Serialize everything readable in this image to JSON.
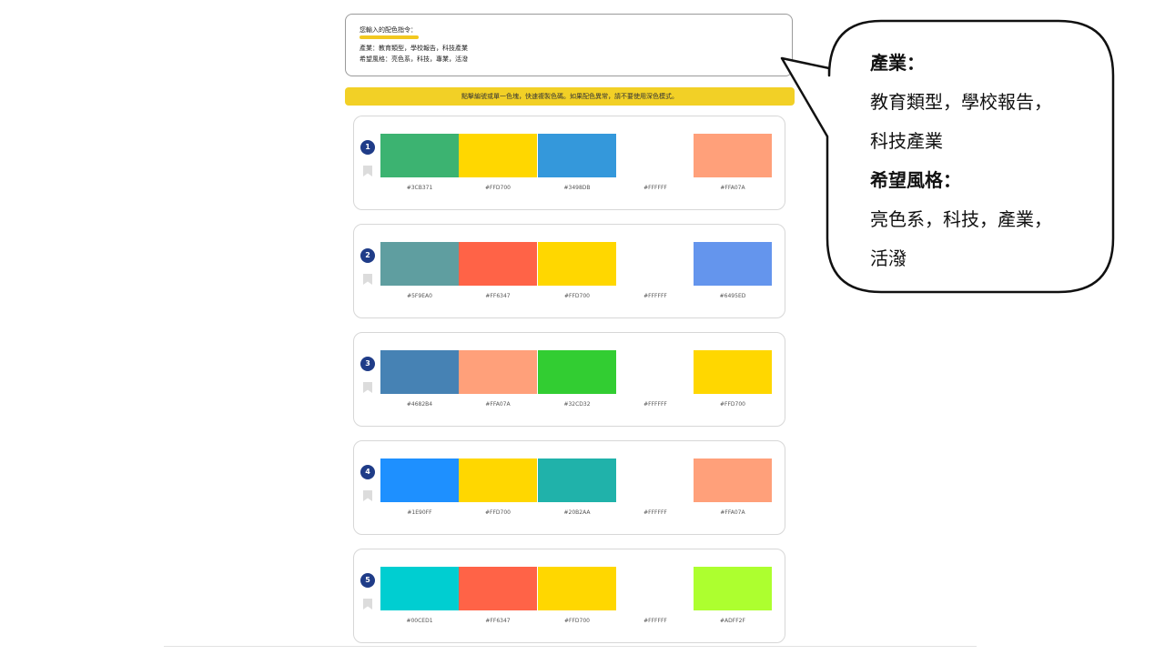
{
  "input_card": {
    "title": "您輸入的配色指令：",
    "line1": "產業：教育類型，學校報告，科技產業",
    "line2": "希望風格：亮色系，科技，專業，活潑"
  },
  "notice": "點擊編號或單一色塊，快速複製色碼。如果配色異常，請不要使用深色模式。",
  "palettes": [
    {
      "number": "1",
      "colors": [
        "#3CB371",
        "#FFD700",
        "#3498DB",
        "#FFFFFF",
        "#FFA07A"
      ],
      "codes": [
        "#3CB371",
        "#FFD700",
        "#3498DB",
        "#FFFFFF",
        "#FFA07A"
      ]
    },
    {
      "number": "2",
      "colors": [
        "#5F9EA0",
        "#FF6347",
        "#FFD700",
        "#FFFFFF",
        "#6495ED"
      ],
      "codes": [
        "#5F9EA0",
        "#FF6347",
        "#FFD700",
        "#FFFFFF",
        "#6495ED"
      ]
    },
    {
      "number": "3",
      "colors": [
        "#4682B4",
        "#FFA07A",
        "#32CD32",
        "#FFFFFF",
        "#FFD700"
      ],
      "codes": [
        "#4682B4",
        "#FFA07A",
        "#32CD32",
        "#FFFFFF",
        "#FFD700"
      ]
    },
    {
      "number": "4",
      "colors": [
        "#1E90FF",
        "#FFD700",
        "#20B2AA",
        "#FFFFFF",
        "#FFA07A"
      ],
      "codes": [
        "#1E90FF",
        "#FFD700",
        "#20B2AA",
        "#FFFFFF",
        "#FFA07A"
      ]
    },
    {
      "number": "5",
      "colors": [
        "#00CED1",
        "#FF6347",
        "#FFD700",
        "#FFFFFF",
        "#ADFF2F"
      ],
      "codes": [
        "#00CED1",
        "#FF6347",
        "#FFD700",
        "#FFFFFF",
        "#ADFF2F"
      ]
    }
  ],
  "callout": {
    "heading1": "產業：",
    "line1a": "教育類型，學校報告，",
    "line1b": "科技產業",
    "heading2": "希望風格：",
    "line2a": "亮色系，科技，產業，",
    "line2b": "活潑"
  },
  "colors": {
    "accent_yellow": "#F2D026",
    "badge_navy": "#1F3C88"
  },
  "icons": {
    "badge": "number-badge-icon",
    "bookmark": "bookmark-icon"
  }
}
